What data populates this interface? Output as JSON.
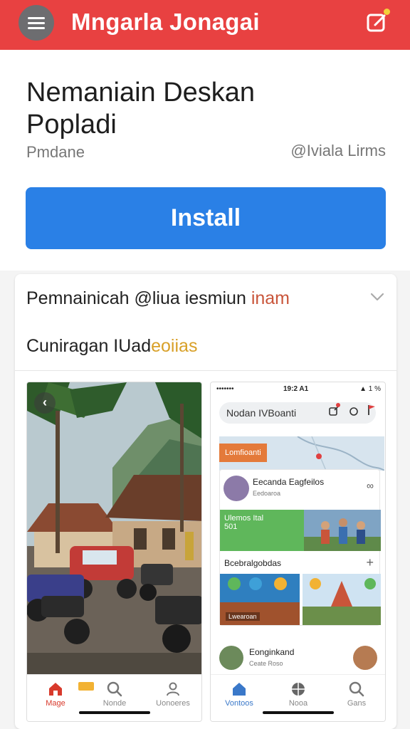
{
  "appbar": {
    "title": "Mngarla Jonagai",
    "menu_icon": "hamburger-menu-icon",
    "edit_icon": "edit-square-icon",
    "color": "#e84141"
  },
  "app": {
    "title": "Nemaniain Deskan Popladi",
    "developer": "Pmdane",
    "rating_text": "@Iviala Lirms",
    "install_label": "Install",
    "install_color": "#2a80e6"
  },
  "section": {
    "title_main": "Pemnainicah @liua iesmiun ",
    "title_highlight": "inam",
    "subtitle_main": "Cuniragan IUad",
    "subtitle_highlight": "eoiias"
  },
  "screenshot1": {
    "nav": [
      {
        "label": "Mage",
        "icon": "home-icon"
      },
      {
        "label": "Nonde",
        "icon": "search-icon"
      },
      {
        "label": "Uonoeres",
        "icon": "profile-icon"
      }
    ]
  },
  "screenshot2": {
    "status_left": "••••••• ",
    "status_time": "19:2 A1",
    "status_right": "▲ 1 %",
    "search_text": "Nodan IVBoanti",
    "map_tag": "Lomfioanti",
    "feed_name": "Eecanda Eagfeilos",
    "feed_meta": "Eedoaroa",
    "banner_text": "Ulemos Ital",
    "banner_sub": "501",
    "feed_section": "Bcebralgobdas",
    "tile_caption": "Lwearoan",
    "row2_name": "Eonginkand",
    "row2_meta": "Ceate Roso",
    "nav": [
      {
        "label": "Vontoos",
        "icon": "home-icon"
      },
      {
        "label": "Nooa",
        "icon": "sports-ball-icon"
      },
      {
        "label": "Gans",
        "icon": "search-icon"
      }
    ]
  }
}
